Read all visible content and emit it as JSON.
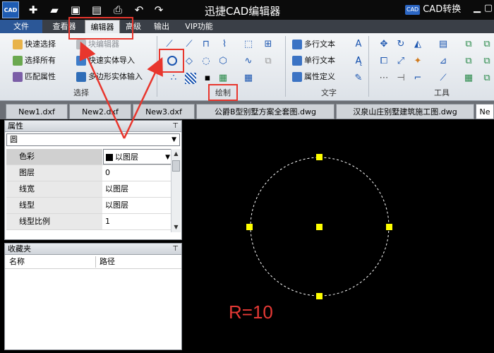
{
  "app": {
    "logo_text": "CAD",
    "title": "迅捷CAD编辑器",
    "convert_badge": "CAD",
    "convert_label": "CAD转换"
  },
  "menu": {
    "tabs": [
      "文件",
      "查看器",
      "编辑器",
      "高级",
      "输出",
      "VIP功能"
    ],
    "active": "编辑器"
  },
  "ribbon": {
    "select_group": {
      "label": "选择",
      "items": [
        "快速选择",
        "选择所有",
        "匹配属性"
      ],
      "block_items": [
        "块编辑器",
        "快速实体导入",
        "多边形实体输入"
      ]
    },
    "draw_group": {
      "label": "绘制"
    },
    "text_group": {
      "label": "文字",
      "items": [
        "多行文本",
        "单行文本",
        "属性定义"
      ]
    },
    "tools_group": {
      "label": "工具"
    }
  },
  "doc_tabs": [
    "New1.dxf",
    "New2.dxf",
    "New3.dxf",
    "公爵B型别墅方案全套图.dwg",
    "汉泉山庄别墅建筑施工图.dwg",
    "Ne"
  ],
  "properties_panel": {
    "title": "属性",
    "object_type": "圆",
    "rows": [
      {
        "key": "色彩",
        "value": "以图层"
      },
      {
        "key": "图层",
        "value": "0"
      },
      {
        "key": "线宽",
        "value": "以图层"
      },
      {
        "key": "线型",
        "value": "以图层"
      },
      {
        "key": "线型比例",
        "value": "1"
      }
    ]
  },
  "favorites_panel": {
    "title": "收藏夹",
    "columns": [
      "名称",
      "路径"
    ]
  },
  "canvas": {
    "radius_label": "R=10",
    "circle_color": "#ffffff",
    "grip_color": "#ffff00"
  },
  "colors": {
    "annotation": "#e8362d",
    "menubar": "#3a3f47",
    "file_tab": "#2b5797"
  }
}
